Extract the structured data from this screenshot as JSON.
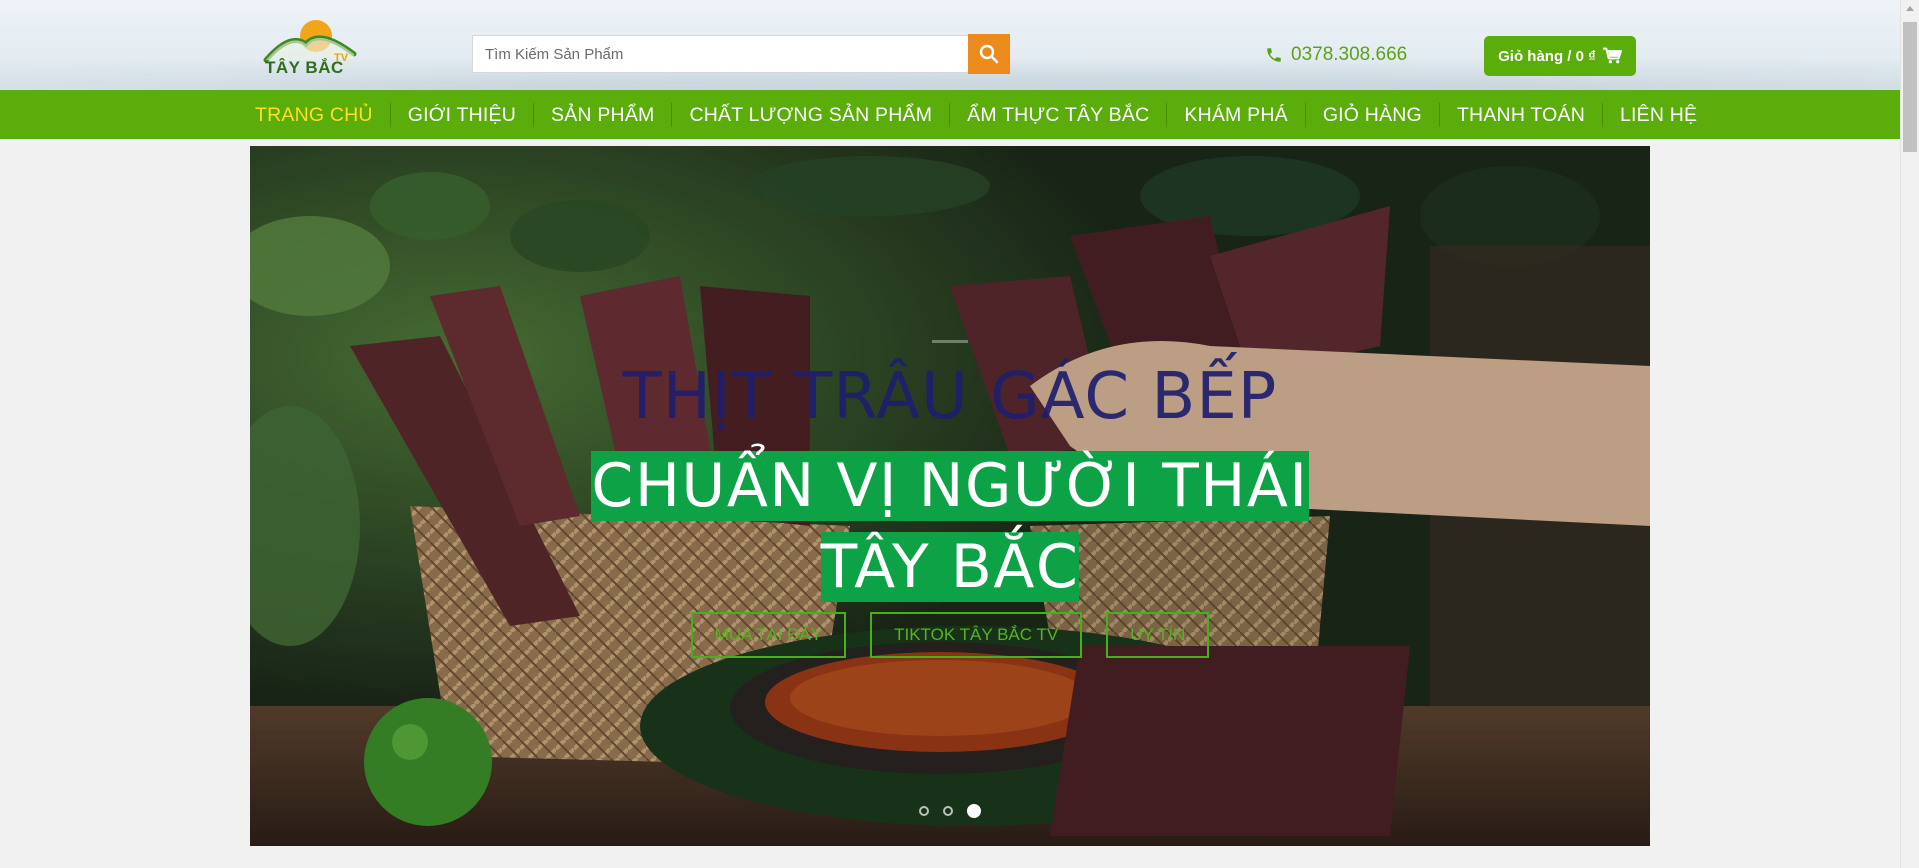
{
  "header": {
    "logo_text": "TÂY BẮC",
    "logo_tv": "TV",
    "search_placeholder": "Tìm Kiếm Sản Phẩm",
    "phone": "0378.308.666",
    "cart_label": "Giỏ hàng / 0 ₫"
  },
  "nav": {
    "items": [
      {
        "label": "TRANG CHỦ",
        "active": true
      },
      {
        "label": "GIỚI THIỆU"
      },
      {
        "label": "SẢN PHẨM"
      },
      {
        "label": "CHẤT LƯỢNG SẢN PHẨM"
      },
      {
        "label": "ẨM THỰC TÂY BẮC"
      },
      {
        "label": "KHÁM PHÁ"
      },
      {
        "label": "GIỎ HÀNG"
      },
      {
        "label": "THANH TOÁN"
      },
      {
        "label": "LIÊN HỆ"
      }
    ]
  },
  "hero": {
    "title": "THỊT TRÂU GÁC BẾP",
    "subtitle": "CHUẨN VỊ NGƯỜI THÁI TÂY BẮC",
    "buttons": [
      "MUA TẠI ĐÂY",
      "TIKTOK TÂY BẮC TV",
      "UY TÍN"
    ],
    "slide_count": 3,
    "active_slide": 3
  },
  "colors": {
    "brand_green": "#5aad0a",
    "accent_orange": "#ec8a1c",
    "active_nav": "#ffdf1f",
    "subtitle_bg": "#0da246",
    "title_navy": "#1e1f6e"
  }
}
